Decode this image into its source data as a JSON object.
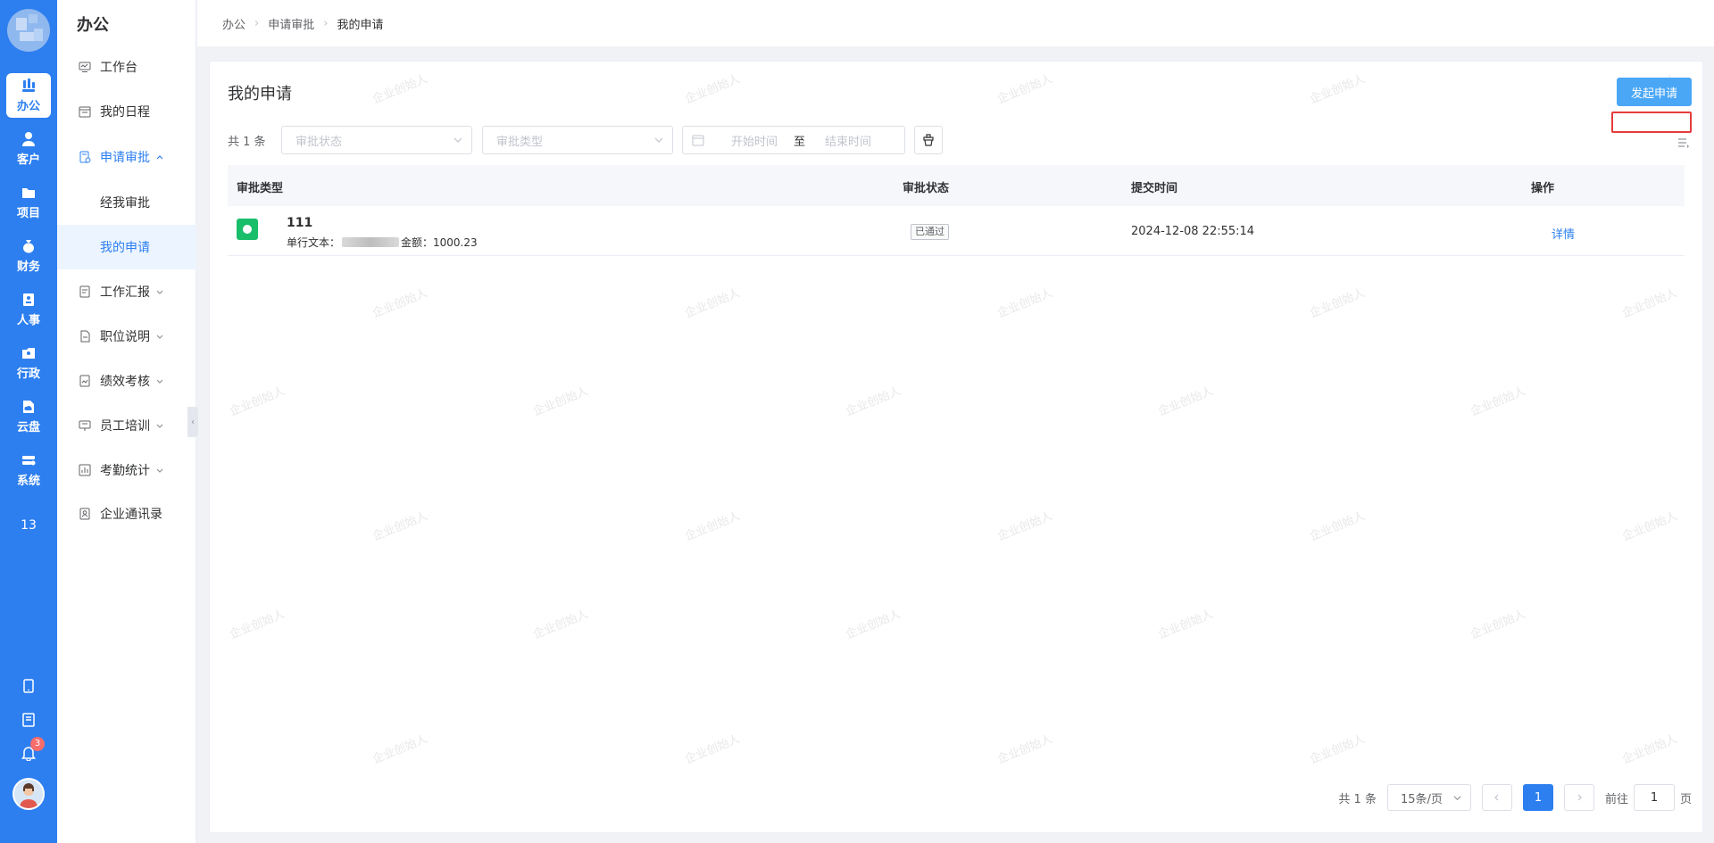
{
  "rail": {
    "items": [
      {
        "label": "办公",
        "icon": "briefcase-icon"
      },
      {
        "label": "客户",
        "icon": "user-icon"
      },
      {
        "label": "项目",
        "icon": "folder-icon"
      },
      {
        "label": "财务",
        "icon": "money-bag-icon"
      },
      {
        "label": "人事",
        "icon": "id-card-icon"
      },
      {
        "label": "行政",
        "icon": "admin-icon"
      },
      {
        "label": "云盘",
        "icon": "cloud-icon"
      },
      {
        "label": "系统",
        "icon": "settings-icon"
      }
    ],
    "number": "13",
    "notification_count": "3",
    "bottom_icons": [
      "phone-icon",
      "book-icon",
      "bell-icon"
    ]
  },
  "sidebar": {
    "title": "办公",
    "items": [
      {
        "label": "工作台",
        "icon": "monitor-icon"
      },
      {
        "label": "我的日程",
        "icon": "calendar-icon"
      },
      {
        "label": "申请审批",
        "icon": "approval-icon"
      },
      {
        "label": "经我审批"
      },
      {
        "label": "我的申请"
      },
      {
        "label": "工作汇报",
        "icon": "report-icon"
      },
      {
        "label": "职位说明",
        "icon": "document-icon"
      },
      {
        "label": "绩效考核",
        "icon": "performance-icon"
      },
      {
        "label": "员工培训",
        "icon": "training-icon"
      },
      {
        "label": "考勤统计",
        "icon": "chart-icon"
      },
      {
        "label": "企业通讯录",
        "icon": "contacts-icon"
      }
    ]
  },
  "breadcrumb": [
    "办公",
    "申请审批",
    "我的申请"
  ],
  "main": {
    "title": "我的申请",
    "new_button": "发起申请",
    "total_label": "共 1 条",
    "filters": {
      "status_placeholder": "审批状态",
      "type_placeholder": "审批类型",
      "start_placeholder": "开始时间",
      "range_sep": "至",
      "end_placeholder": "结束时间"
    },
    "table": {
      "headers": [
        "审批类型",
        "审批状态",
        "提交时间",
        "操作"
      ],
      "rows": [
        {
          "name": "111",
          "desc_label": "单行文本：",
          "amount": "金额：1000.23",
          "status": "已通过",
          "time": "2024-12-08 22:55:14",
          "action": "详情"
        }
      ]
    },
    "pagination": {
      "total": "共 1 条",
      "page_size": "15条/页",
      "current": "1",
      "goto_label": "前往",
      "goto_value": "1",
      "page_suffix": "页"
    }
  },
  "watermark": "企业创始人",
  "colors": {
    "primary": "#2d7ff0",
    "button": "#4aa7f6",
    "success": "#19be6b",
    "highlight": "#e63b3b"
  }
}
